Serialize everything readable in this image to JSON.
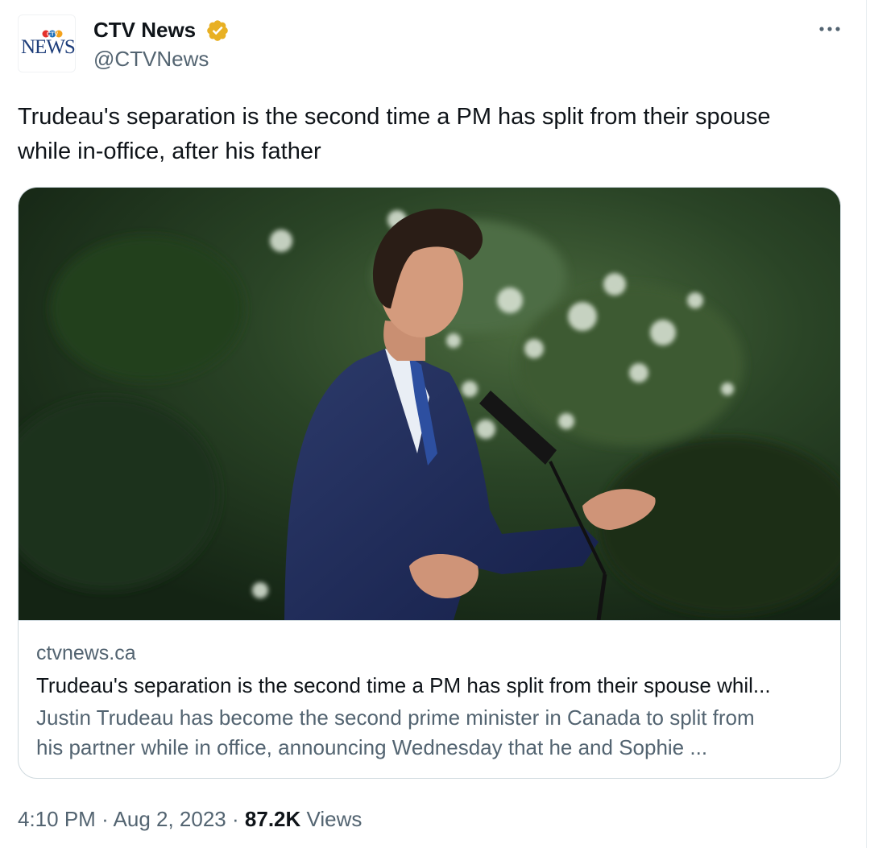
{
  "tweet": {
    "author": {
      "name": "CTV News",
      "handle": "@CTVNews",
      "avatar": {
        "logo_text": "NEWS",
        "logo_mark": "CTV",
        "logo_mark_colors": [
          "#e4312b",
          "#1d6fb8",
          "#f4a21b"
        ]
      },
      "verified": true,
      "verified_badge_color": "#e8b023"
    },
    "more_icon": "more-horizontal-icon",
    "text": "Trudeau's separation is the second time a PM has split from their spouse\nwhile in-office, after his father",
    "card": {
      "image_icon": "photo-speaker-at-microphone",
      "domain": "ctvnews.ca",
      "title": "Trudeau's separation is the second time a PM has split from their spouse whil...",
      "description": "Justin Trudeau has become the second prime minister in Canada to split from\nhis partner while in office, announcing Wednesday that he and Sophie ..."
    },
    "meta": {
      "time": "4:10 PM",
      "separator": "·",
      "date": "Aug 2, 2023",
      "views_count": "87.2K",
      "views_label": "Views"
    }
  },
  "colors": {
    "text_primary": "#0f1419",
    "text_secondary": "#536471",
    "border": "#cfd9de"
  }
}
